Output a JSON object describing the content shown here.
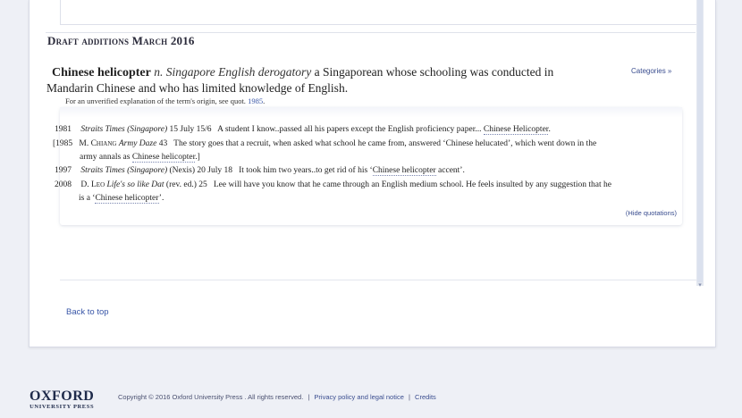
{
  "section_title": "Draft additions March 2016",
  "entry": {
    "headword": "Chinese helicopter",
    "pos": "n. Singapore English derogatory",
    "definition_1": " a Singaporean whose schooling was conducted in",
    "definition_2": "Mandarin Chinese and who has limited knowledge of English.",
    "categories_link": "Categories »",
    "note_text": "For an unverified explanation of the term's origin, see quot. ",
    "note_link": "1985",
    "note_end": "."
  },
  "quotations": [
    {
      "year": "1981",
      "source": "Straits Times (Singapore)",
      "ref": " 15 July 15/6",
      "text": "A student I know..passed all his papers except the English proficiency paper... ",
      "highlight": "Chinese Helicopter",
      "after": ".",
      "cont": ""
    },
    {
      "year": "[1985",
      "author": "M. Chiang",
      "source": "Army Daze",
      "ref": " 43",
      "text": "The story goes that a recruit, when asked what school he came from, answered ‘Chinese helucated’, which went down in the",
      "cont_pre": "army annals as ",
      "highlight": "Chinese helicopter",
      "after": ".]"
    },
    {
      "year": "1997",
      "source": "Straits Times (Singapore)",
      "ref": " (Nexis) 20 July 18",
      "text": "It took him two years..to get rid of his ‘",
      "highlight": "Chinese helicopter",
      "after": " accent’."
    },
    {
      "year": "2008",
      "author": "D. Leo",
      "source": "Life's so like Dat",
      "ref": " (rev. ed.) 25",
      "text": "Lee will have you know that he came through an English medium school. He feels insulted by any suggestion that he",
      "cont_pre": "is a ‘",
      "highlight": "Chinese helicopter",
      "after": "’."
    }
  ],
  "hide_quotations": "(Hide quotations)",
  "back_to_top": "Back to top",
  "footer": {
    "logo_big": "OXFORD",
    "logo_small": "UNIVERSITY PRESS",
    "copyright": "Copyright © 2016 Oxford University Press . All rights reserved.",
    "sep": "|",
    "privacy": "Privacy policy and legal notice",
    "credits": "Credits"
  }
}
